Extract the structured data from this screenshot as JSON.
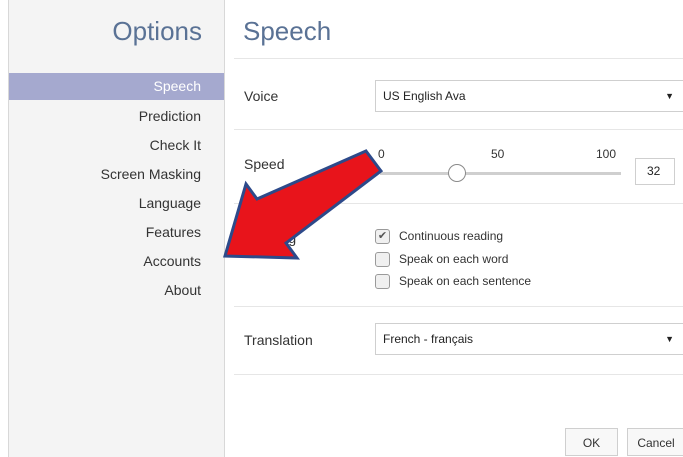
{
  "sidebar": {
    "title": "Options",
    "items": [
      {
        "label": "Speech"
      },
      {
        "label": "Prediction"
      },
      {
        "label": "Check It"
      },
      {
        "label": "Screen Masking"
      },
      {
        "label": "Language"
      },
      {
        "label": "Features"
      },
      {
        "label": "Accounts"
      },
      {
        "label": "About"
      }
    ]
  },
  "main": {
    "title": "Speech",
    "voice": {
      "label": "Voice",
      "value": "US English Ava"
    },
    "speed": {
      "label": "Speed",
      "ticks": [
        "0",
        "50",
        "100"
      ],
      "value": "32",
      "slider_fraction": 0.32
    },
    "reading": {
      "label": "Reading",
      "options": [
        {
          "label": "Continuous reading",
          "checked": true
        },
        {
          "label": "Speak on each word",
          "checked": false
        },
        {
          "label": "Speak on each sentence",
          "checked": false
        }
      ]
    },
    "translation": {
      "label": "Translation",
      "value": "French - français"
    }
  },
  "footer": {
    "ok_label": "OK",
    "cancel_label": "Cancel"
  },
  "colors": {
    "accent": "#a5a9cf",
    "title": "#5a7295",
    "arrow_fill": "#e8141b",
    "arrow_border": "#2d4a8a"
  },
  "overlay": {
    "icon": "red-arrow-icon"
  }
}
